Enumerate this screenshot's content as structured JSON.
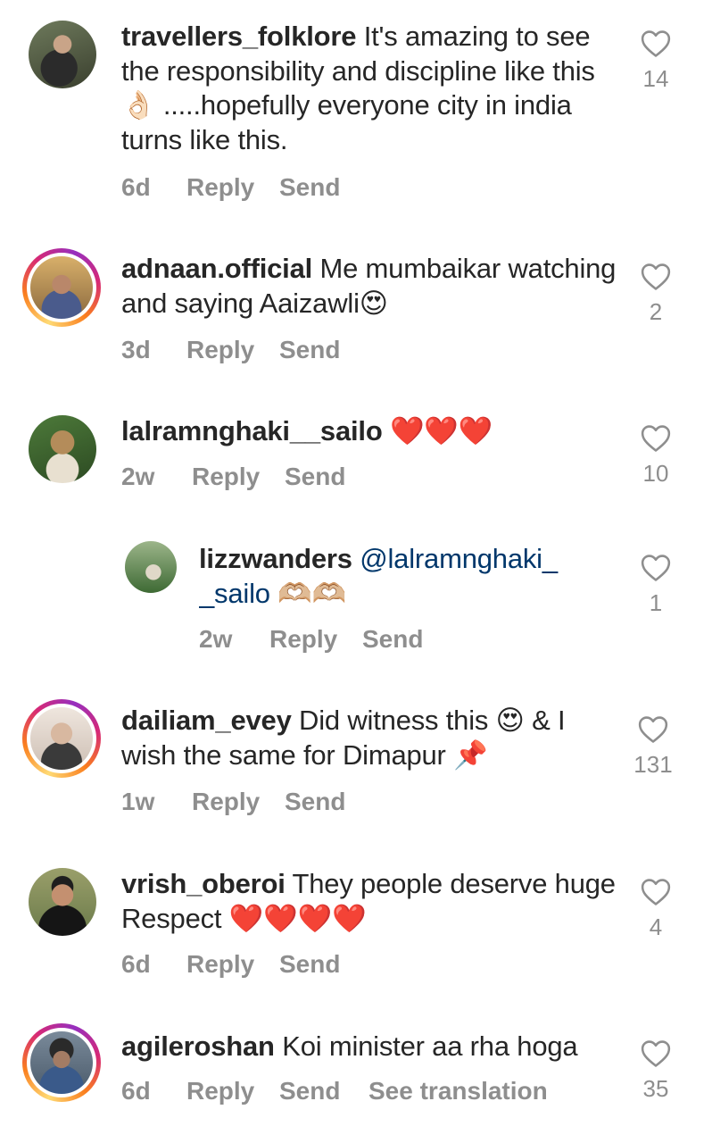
{
  "comments": [
    {
      "username": "travellers_folklore",
      "text": "It's amazing to see the responsibility and discipline like this👌🏻 .....hopefully everyone city in india turns like this.",
      "time": "6d",
      "reply": "Reply",
      "send": "Send",
      "likes": "14"
    },
    {
      "username": "adnaan.official",
      "text": "Me mumbaikar watching and saying Aaizawli😍",
      "time": "3d",
      "reply": "Reply",
      "send": "Send",
      "likes": "2"
    },
    {
      "username": "lalramnghaki__sailo",
      "text": "❤️❤️❤️",
      "time": "2w",
      "reply": "Reply",
      "send": "Send",
      "likes": "10"
    },
    {
      "username": "lizzwanders",
      "mention": "@lalramnghaki__sailo",
      "text": "🫶🏼🫶🏼",
      "time": "2w",
      "reply": "Reply",
      "send": "Send",
      "likes": "1"
    },
    {
      "username": "dailiam_evey",
      "text": "Did witness this 😍 & I wish the same for Dimapur 📌",
      "time": "1w",
      "reply": "Reply",
      "send": "Send",
      "likes": "131"
    },
    {
      "username": "vrish_oberoi",
      "text": "They people deserve huge Respect ❤️❤️❤️❤️",
      "time": "6d",
      "reply": "Reply",
      "send": "Send",
      "likes": "4"
    },
    {
      "username": "agileroshan",
      "text": "Koi minister aa rha hoga",
      "time": "6d",
      "reply": "Reply",
      "send": "Send",
      "see_translation": "See translation",
      "likes": "35"
    }
  ],
  "icons": {
    "like": "heart-outline-icon"
  },
  "colors": {
    "text": "#262626",
    "meta": "#8e8e8e",
    "mention": "#00376b",
    "story_ring": [
      "#feda75",
      "#fa7e1e",
      "#d62976",
      "#962fbf"
    ]
  }
}
